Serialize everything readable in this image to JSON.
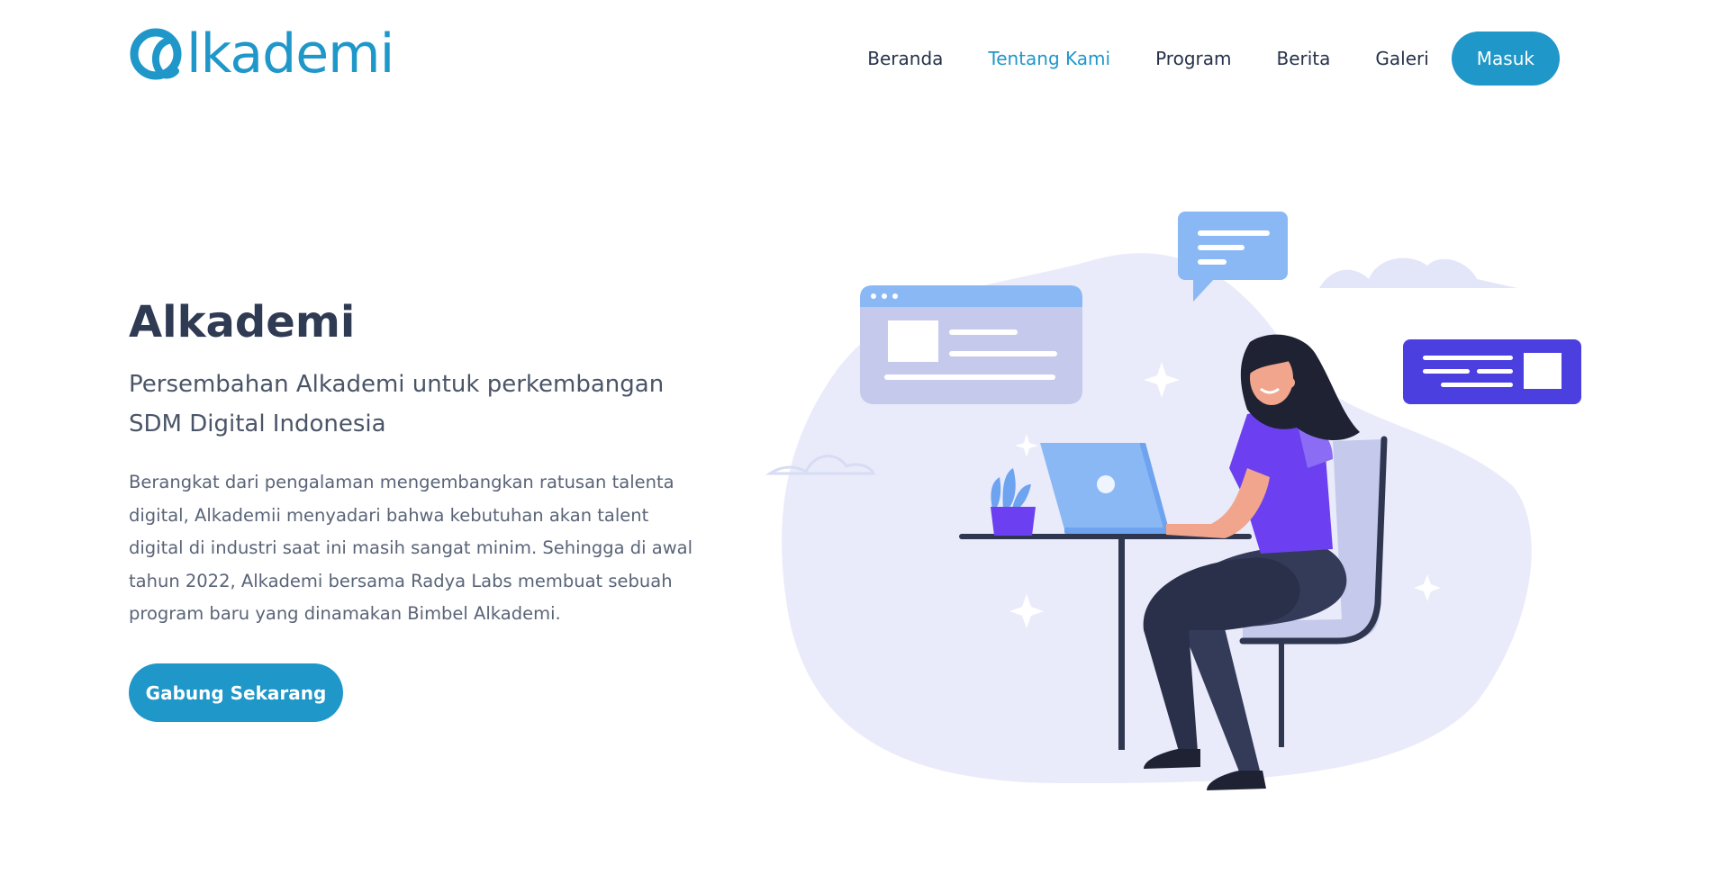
{
  "header": {
    "logo_text": "lkademi",
    "nav": [
      {
        "label": "Beranda",
        "active": false
      },
      {
        "label": "Tentang Kami",
        "active": true
      },
      {
        "label": "Program",
        "active": false
      },
      {
        "label": "Berita",
        "active": false
      },
      {
        "label": "Galeri",
        "active": false
      }
    ],
    "login_label": "Masuk"
  },
  "hero": {
    "title": "Alkademi",
    "subtitle": "Persembahan Alkademi untuk perkembangan SDM Digital Indonesia",
    "description": "Berangkat dari pengalaman mengembangkan ratusan talenta digital, Alkademii menyadari bahwa kebutuhan akan talent digital di industri saat ini masih sangat minim. Sehingga di awal tahun 2022, Alkademi bersama Radya Labs membuat sebuah program baru yang dinamakan Bimbel Alkademi.",
    "cta_label": "Gabung Sekarang"
  },
  "colors": {
    "brand": "#1f97c9",
    "heading": "#2f3a53",
    "nav_text": "#26324a",
    "blob": "#e9ebfa",
    "purple": "#6c3ff0"
  },
  "icons": {
    "logo": "alkademi-a-mark",
    "illustration": "woman-working-on-laptop"
  }
}
